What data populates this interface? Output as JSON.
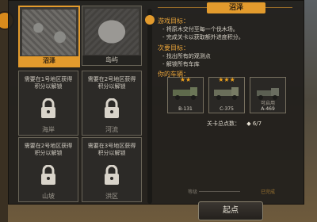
{
  "maps": [
    {
      "name": "沼泽",
      "state": "selected",
      "thumb": "terrain-a"
    },
    {
      "name": "岛屿",
      "state": "unlocked",
      "thumb": "terrain-b"
    },
    {
      "name": "海岸",
      "state": "locked",
      "requirement": "需要在1号地区获得 积分以解锁"
    },
    {
      "name": "河流",
      "state": "locked",
      "requirement": "需要在2号地区获得 积分以解锁"
    },
    {
      "name": "山坡",
      "state": "locked",
      "requirement": "需要在2号地区获得 积分以解锁"
    },
    {
      "name": "洪区",
      "state": "locked",
      "requirement": "需要在3号地区获得 积分以解锁"
    }
  ],
  "info": {
    "title": "沼泽",
    "game_goals_title": "游戏目标：",
    "game_goals": [
      "- 将原木交付至每一个伐木场。",
      "- 完成关卡以获取额外进度积分。"
    ],
    "secondary_goals_title": "次要目标：",
    "secondary_goals": [
      "- 找出所有的观测点",
      "- 解锁所有车库"
    ],
    "trucks_title": "你的车辆：",
    "trucks": [
      {
        "code": "B-131",
        "stars": "★★",
        "sub": ""
      },
      {
        "code": "C-375",
        "stars": "★★★",
        "sub": ""
      },
      {
        "code": "A-469",
        "stars": "",
        "sub": "可启用"
      }
    ],
    "points_label": "关卡总点数：",
    "points_value": "◆ 6/7",
    "lock_left": "等级",
    "lock_right": "已完成"
  },
  "start_button": "起点",
  "colors": {
    "accent": "#e39b2d"
  }
}
